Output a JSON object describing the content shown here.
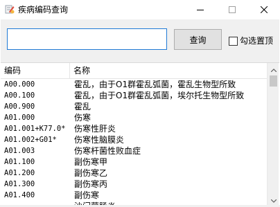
{
  "window": {
    "title": "疾病编码查询"
  },
  "toolbar": {
    "search_value": "",
    "query_label": "查询",
    "pin_label": "勾选置顶",
    "pin_checked": false
  },
  "table": {
    "columns": [
      "编码",
      "名称"
    ],
    "rows": [
      {
        "code": "A00.000",
        "name": "霍乱，由于O1群霍乱弧菌，霍乱生物型所致"
      },
      {
        "code": "A00.100",
        "name": "霍乱，由于O1群霍乱弧菌，埃尔托生物型所致"
      },
      {
        "code": "A00.900",
        "name": "霍乱"
      },
      {
        "code": "A01.000",
        "name": "伤寒"
      },
      {
        "code": "A01.001+K77.0*",
        "name": "伤寒性肝炎"
      },
      {
        "code": "A01.002+G01*",
        "name": "伤寒性脑膜炎"
      },
      {
        "code": "A01.003",
        "name": "伤寒杆菌性败血症"
      },
      {
        "code": "A01.100",
        "name": "副伤寒甲"
      },
      {
        "code": "A01.200",
        "name": "副伤寒乙"
      },
      {
        "code": "A01.300",
        "name": "副伤寒丙"
      },
      {
        "code": "A01.400",
        "name": "副伤寒"
      },
      {
        "code": "",
        "name": "沙门菌肠炎"
      }
    ]
  },
  "icons": {
    "app": "app-icon",
    "minimize": "minimize-icon",
    "maximize": "maximize-icon",
    "close": "close-icon",
    "scroll_up": "chevron-up-icon",
    "scroll_down": "chevron-down-icon"
  }
}
